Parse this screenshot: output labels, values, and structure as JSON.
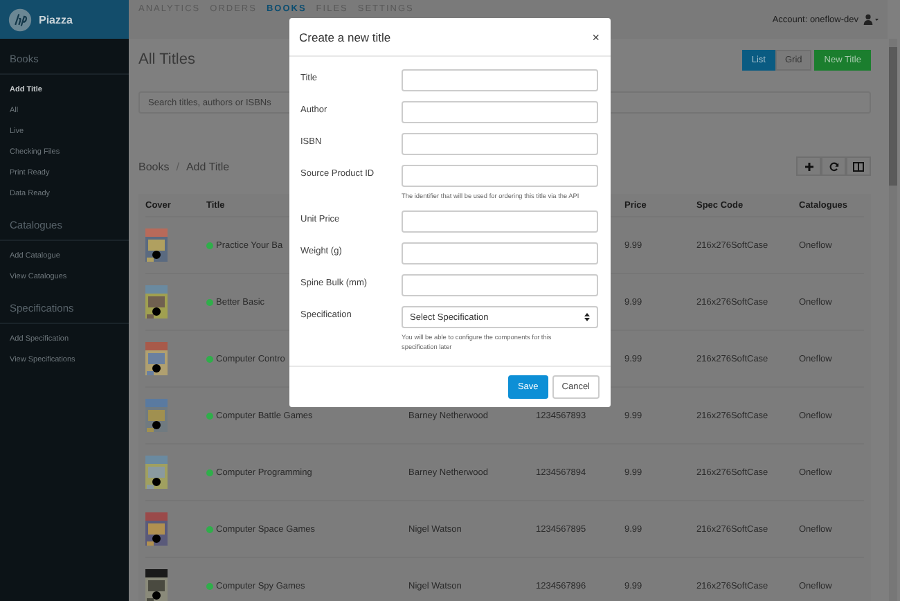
{
  "header": {
    "logo": "Piazza",
    "nav": [
      {
        "label": "ANALYTICS",
        "selected": false
      },
      {
        "label": "ORDERS",
        "selected": false
      },
      {
        "label": "BOOKS",
        "selected": true
      },
      {
        "label": "FILES",
        "selected": false
      },
      {
        "label": "SETTINGS",
        "selected": false
      }
    ],
    "account": "Account: oneflow-dev"
  },
  "sidebar": {
    "sections": [
      {
        "title": "Books",
        "items": [
          {
            "label": "Add Title",
            "selected": true
          },
          {
            "label": "All",
            "selected": false
          },
          {
            "label": "Live",
            "selected": false
          },
          {
            "label": "Checking Files",
            "selected": false
          },
          {
            "label": "Print Ready",
            "selected": false
          },
          {
            "label": "Data Ready",
            "selected": false
          }
        ]
      },
      {
        "title": "Catalogues",
        "items": [
          {
            "label": "Add Catalogue",
            "selected": false
          },
          {
            "label": "View Catalogues",
            "selected": false
          }
        ]
      },
      {
        "title": "Specifications",
        "items": [
          {
            "label": "Add Specification",
            "selected": false
          },
          {
            "label": "View Specifications",
            "selected": false
          }
        ]
      }
    ]
  },
  "main": {
    "title": "All Titles",
    "view_toggle": [
      {
        "label": "List",
        "selected": true
      },
      {
        "label": "Grid",
        "selected": false
      }
    ],
    "new_button": "New Title",
    "search": {
      "placeholder": "Search titles, authors or ISBNs"
    },
    "breadcrumb": {
      "items": [
        "Books",
        "Add Title"
      ],
      "separator": "/"
    },
    "table": {
      "columns": [
        "Cover",
        "Title",
        "Price",
        "Spec Code",
        "Catalogues"
      ],
      "rows": [
        {
          "title": "Practice Your Ba",
          "color": "#2fae4a",
          "price": "9.99",
          "spec_code": "216x276SoftCase",
          "catalogues": "Oneflow"
        },
        {
          "title": "Better Basic",
          "color": "#2fae4a",
          "price": "9.99",
          "spec_code": "216x276SoftCase",
          "catalogues": "Oneflow"
        },
        {
          "title": "Computer Contro",
          "color": "#2fae4a",
          "price": "9.99",
          "spec_code": "216x276SoftCase",
          "catalogues": "Oneflow"
        },
        {
          "title": "Computer Battle Games",
          "color": "#2fae4a",
          "author": "Barney Netherwood",
          "isbn": "1234567893",
          "price": "9.99",
          "spec_code": "216x276SoftCase",
          "catalogues": "Oneflow"
        },
        {
          "title": "Computer Programming",
          "color": "#2fae4a",
          "author": "Barney Netherwood",
          "isbn": "1234567894",
          "price": "9.99",
          "spec_code": "216x276SoftCase",
          "catalogues": "Oneflow"
        },
        {
          "title": "Computer Space Games",
          "color": "#2fae4a",
          "author": "Nigel Watson",
          "isbn": "1234567895",
          "price": "9.99",
          "spec_code": "216x276SoftCase",
          "catalogues": "Oneflow"
        },
        {
          "title": "Computer Spy Games",
          "color": "#2fae4a",
          "author": "Nigel Watson",
          "isbn": "1234567896",
          "price": "9.99",
          "spec_code": "216x276SoftCase",
          "catalogues": "Oneflow"
        }
      ]
    }
  },
  "modal": {
    "title": "Create a new title",
    "close": "×",
    "fields": [
      {
        "kind": "text",
        "label": "Title"
      },
      {
        "kind": "text",
        "label": "Author"
      },
      {
        "kind": "text",
        "label": "ISBN"
      },
      {
        "kind": "text",
        "label": "Source Product ID",
        "help": "The identifier that will be used for ordering this title via the API"
      },
      {
        "kind": "text",
        "label": "Unit Price"
      },
      {
        "kind": "text",
        "label": "Weight (g)"
      },
      {
        "kind": "text",
        "label": "Spine Bulk (mm)"
      },
      {
        "kind": "select",
        "label": "Specification",
        "value": "Select Specification",
        "help": "You will be able to configure the components for this specification later"
      }
    ],
    "buttons": [
      {
        "kind": "primary",
        "label": "Save"
      },
      {
        "kind": "default",
        "label": "Cancel"
      }
    ]
  }
}
